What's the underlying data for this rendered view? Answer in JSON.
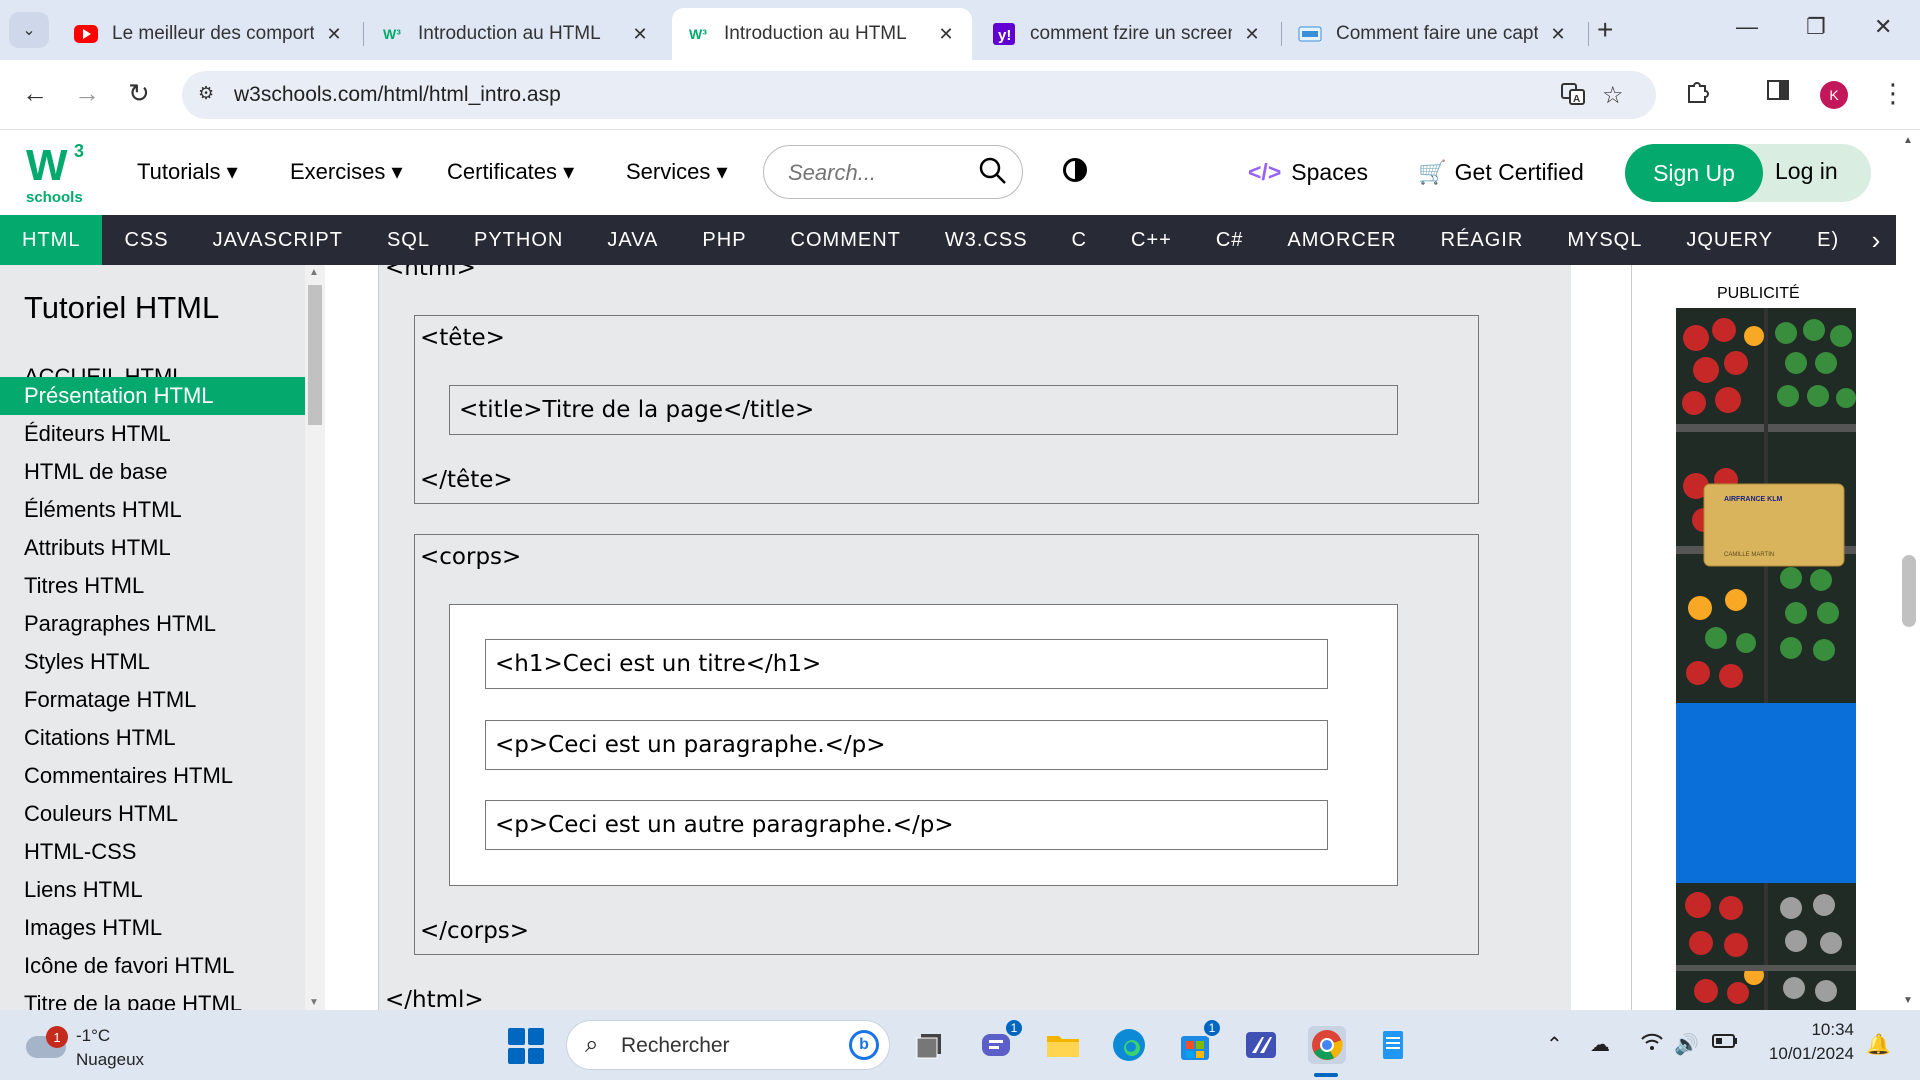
{
  "browser": {
    "tabs": [
      {
        "title": "Le meilleur des comporte",
        "favicon": "youtube-icon",
        "active": false
      },
      {
        "title": "Introduction au HTML",
        "favicon": "w3schools-icon",
        "active": false
      },
      {
        "title": "Introduction au HTML",
        "favicon": "w3schools-icon",
        "active": true
      },
      {
        "title": "comment fzire un screen",
        "favicon": "yahoo-icon",
        "active": false
      },
      {
        "title": "Comment faire une captu",
        "favicon": "justgeek-icon",
        "active": false
      }
    ],
    "tab_close": "✕",
    "new_tab": "+",
    "url": "w3schools.com/html/html_intro.asp",
    "profile_initial": "K"
  },
  "w3": {
    "logo_letter": "W",
    "logo_superscript": "3",
    "logo_text": "schools",
    "menu": [
      {
        "label": "Tutorials ▾"
      },
      {
        "label": "Exercises ▾"
      },
      {
        "label": "Certificates ▾"
      },
      {
        "label": "Services ▾"
      }
    ],
    "search_placeholder": "Search...",
    "spaces": "Spaces",
    "get_certified": "Get Certified",
    "sign_up": "Sign Up",
    "log_in": "Log in",
    "accent_color": "#04aa6d"
  },
  "topics": [
    "HTML",
    "CSS",
    "JAVASCRIPT",
    "SQL",
    "PYTHON",
    "JAVA",
    "PHP",
    "COMMENT",
    "W3.CSS",
    "C",
    "C++",
    "C#",
    "AMORCER",
    "RÉAGIR",
    "MYSQL",
    "JQUERY",
    "E)"
  ],
  "sidebar": {
    "title": "Tutoriel HTML",
    "items": [
      "ACCUEIL HTML",
      "Présentation HTML",
      "Éditeurs HTML",
      "HTML de base",
      "Éléments HTML",
      "Attributs HTML",
      "Titres HTML",
      "Paragraphes HTML",
      "Styles HTML",
      "Formatage HTML",
      "Citations HTML",
      "Commentaires HTML",
      "Couleurs HTML",
      "HTML-CSS",
      "Liens HTML",
      "Images HTML",
      "Icône de favori HTML",
      "Titre de la page HTML"
    ],
    "active_index": 1
  },
  "diagram": {
    "html_open": "<html>",
    "head_open": "<tête>",
    "title_tag": "<title>Titre de la page</title>",
    "head_close": "</tête>",
    "body_open": "<corps>",
    "h1_tag": "<h1>Ceci est un titre</h1>",
    "p1_tag": "<p>Ceci est un paragraphe.</p>",
    "p2_tag": "<p>Ceci est un autre paragraphe.</p>",
    "body_close": "</corps>",
    "html_close": "</html>"
  },
  "ad": {
    "label": "PUBLICITÉ",
    "card_brand": "AIRFRANCE KLM",
    "card_name": "CAMILLE MARTIN"
  },
  "taskbar": {
    "weather_badge": "1",
    "temperature": "-1°C",
    "condition": "Nuageux",
    "search_placeholder": "Rechercher",
    "teams_badge": "1",
    "store_badge": "1",
    "time": "10:34",
    "date": "10/01/2024"
  }
}
